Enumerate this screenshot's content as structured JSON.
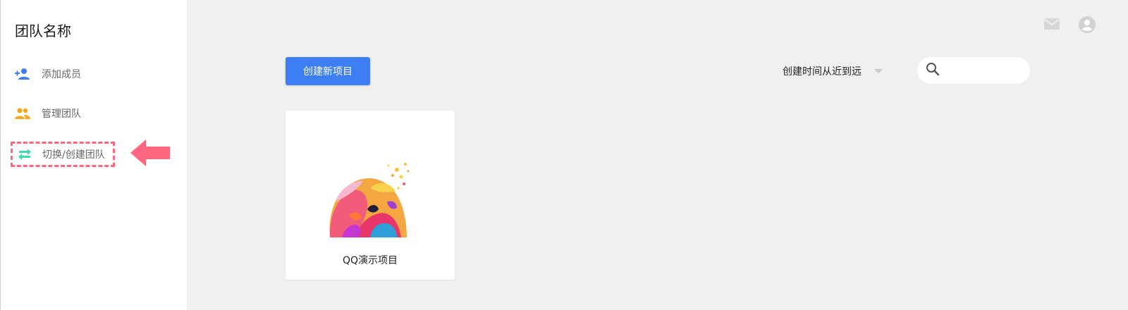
{
  "sidebar": {
    "team_name": "团队名称",
    "items": [
      {
        "label": "添加成员",
        "icon": "add-person-icon",
        "color": "#3d7ff3"
      },
      {
        "label": "管理团队",
        "icon": "group-icon",
        "color": "#f5a623"
      },
      {
        "label": "切换/创建团队",
        "icon": "swap-icon",
        "color": "#3ddcb0"
      }
    ]
  },
  "header": {
    "mail_icon": "mail-icon",
    "user_icon": "account-circle-icon"
  },
  "toolbar": {
    "create_label": "创建新项目",
    "sort_label": "创建时间从近到远",
    "search_placeholder": ""
  },
  "projects": [
    {
      "name": "QQ演示项目"
    }
  ],
  "colors": {
    "accent": "#3d7ff3",
    "highlight": "#ff6680",
    "background": "#f0f0f0"
  }
}
